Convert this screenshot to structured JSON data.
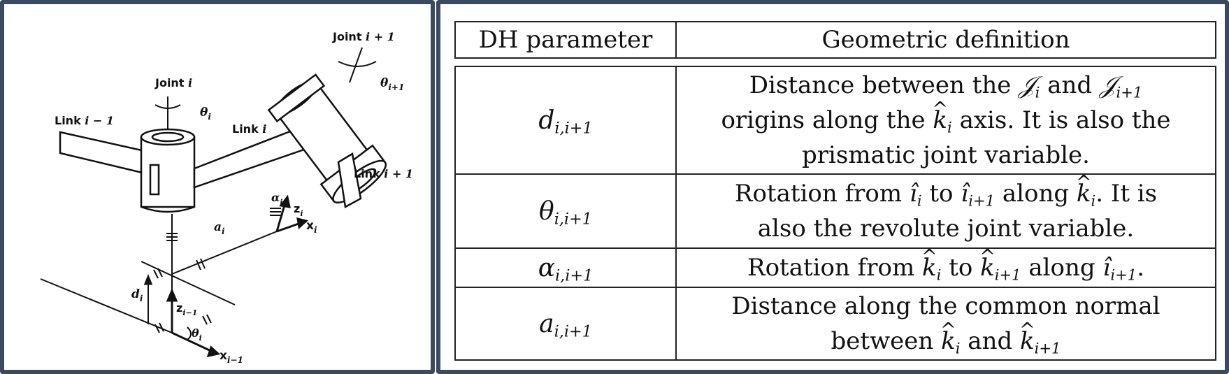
{
  "diagram": {
    "joint_prev_label": "Joint",
    "joint_next_label": "Joint",
    "link_prev_label": "Link",
    "link_mid_label": "Link",
    "link_next_label": "Link",
    "i": "i",
    "i_minus_1": "i − 1",
    "i_plus_1": "i + 1",
    "theta": "θ",
    "alpha": "α",
    "a": "a",
    "d": "d",
    "x": "x",
    "z": "z",
    "sub_i": "i",
    "sub_i_plus_1": "i+1",
    "sub_i_minus_1": "i−1"
  },
  "table": {
    "header": {
      "param": "DH parameter",
      "definition": "Geometric definition"
    },
    "rows": [
      {
        "param_sym": "d",
        "param_sub": "i,i+1",
        "def": "Distance between the 𝒥ᵢ and 𝒥ᵢ₊₁ origins along the k̂ᵢ axis. It is also the prismatic joint variable."
      },
      {
        "param_sym": "θ",
        "param_sub": "i,i+1",
        "def": "Rotation from îᵢ to îᵢ₊₁ along k̂ᵢ. It is also the revolute joint variable."
      },
      {
        "param_sym": "α",
        "param_sub": "i,i+1",
        "def": "Rotation from k̂ᵢ to k̂ᵢ₊₁ along îᵢ₊₁."
      },
      {
        "param_sym": "a",
        "param_sub": "i,i+1",
        "def": "Distance along the common normal between k̂ᵢ and k̂ᵢ₊₁"
      }
    ]
  }
}
